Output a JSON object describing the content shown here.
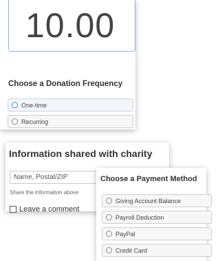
{
  "amount": {
    "value": "10.00"
  },
  "frequency": {
    "heading": "Choose a Donation Frequency",
    "options": [
      {
        "label": "One-time",
        "selected": true
      },
      {
        "label": "Recurring",
        "selected": false
      }
    ]
  },
  "info": {
    "heading": "Information shared with charity",
    "select_value": "Name, Postal/ZIP",
    "share_text": "Share the information above",
    "comment_label": "Leave a comment"
  },
  "payment": {
    "heading": "Choose a Payment Method",
    "options": [
      {
        "label": "Giving Account Balance"
      },
      {
        "label": "Payroll Deduction"
      },
      {
        "label": "PayPal"
      },
      {
        "label": "Credit Card"
      }
    ]
  },
  "colors": {
    "accent": "#3f86d0",
    "border": "#8fb5dc"
  }
}
